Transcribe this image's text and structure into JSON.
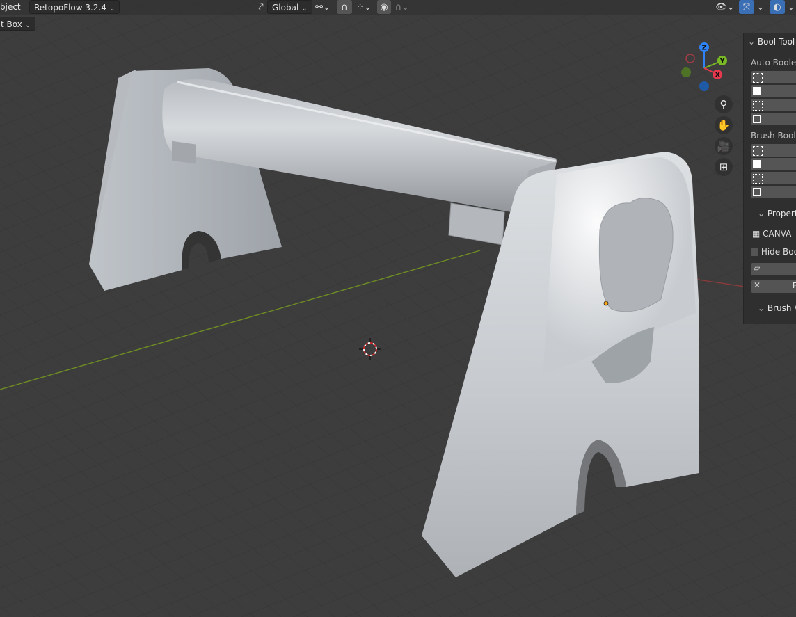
{
  "header": {
    "mode_label": "bject",
    "addon_label": "RetopoFlow 3.2.4",
    "orientation_label": "Global",
    "tool_label": "t Box"
  },
  "gizmo": {
    "x": "X",
    "y": "Y",
    "z": "Z"
  },
  "panel": {
    "title": "Bool Tool",
    "auto_boolean_label": "Auto Boolea",
    "brush_boolean_label": "Brush Boole",
    "properties_label": "Propert",
    "canvas_label": "CANVA",
    "hide_bool_label": "Hide Boo",
    "brush_label": "Brush V",
    "row_letter": "F"
  },
  "colors": {
    "viewport_bg": "#3d3d3d",
    "grid_line": "#343434",
    "x_axis": "#8a3a3a",
    "y_axis": "#6f8d23",
    "model": "#c9cdd2",
    "gizmo_x": "#e8384d",
    "gizmo_y": "#78b925",
    "gizmo_z": "#2f83f5"
  }
}
